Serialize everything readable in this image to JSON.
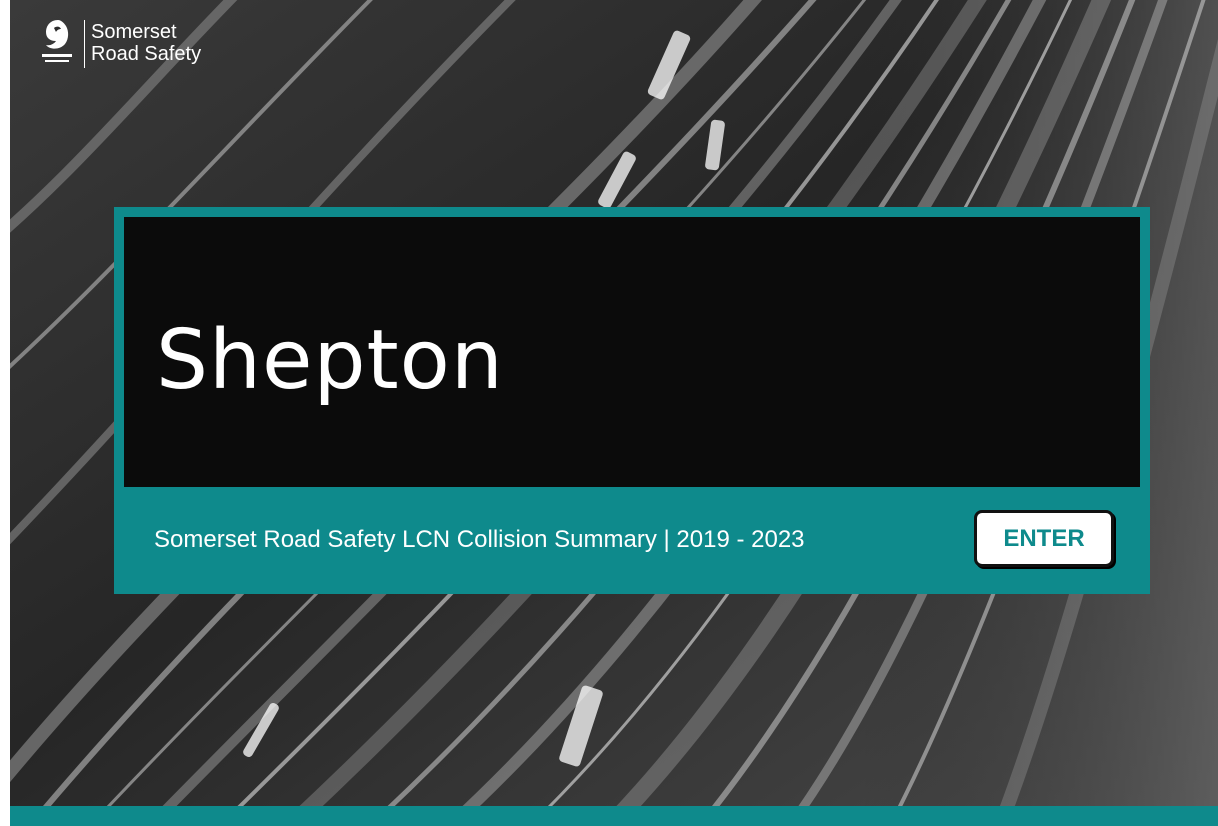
{
  "brand": {
    "line1": "Somerset",
    "line2": "Road Safety",
    "logo_icon": "somerset-crest-icon"
  },
  "card": {
    "title": "Shepton",
    "subtitle": "Somerset Road Safety LCN Collision Summary |  2019 - 2023",
    "enter_label": "ENTER"
  },
  "colors": {
    "accent": "#0e8a8c",
    "title_panel": "#0b0b0b",
    "button_bg": "#ffffff",
    "button_text": "#0e8a8c"
  }
}
